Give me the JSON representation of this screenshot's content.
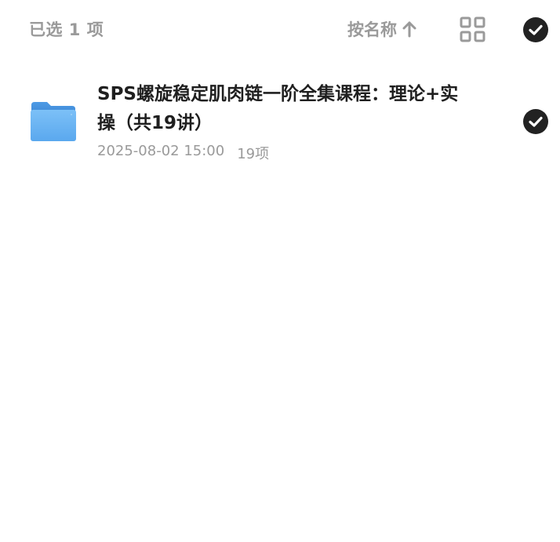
{
  "header": {
    "selected_count": "已选 1 项",
    "sort_label": "按名称",
    "sort_icon": "arrow-up-icon",
    "view_icon": "grid-view-icon",
    "select_all_icon": "check-circle-icon"
  },
  "files": [
    {
      "name": "SPS螺旋稳定肌肉链一阶全集课程：理论+实操（共19讲）",
      "date": "2025-08-02 15:00",
      "item_count": "19项",
      "type_icon": "folder-icon",
      "selected": true
    }
  ],
  "colors": {
    "muted_text": "#9a9a9a",
    "title_text": "#1f1f1f",
    "check_fill": "#222222",
    "folder_blue": "#5aaaf0"
  }
}
